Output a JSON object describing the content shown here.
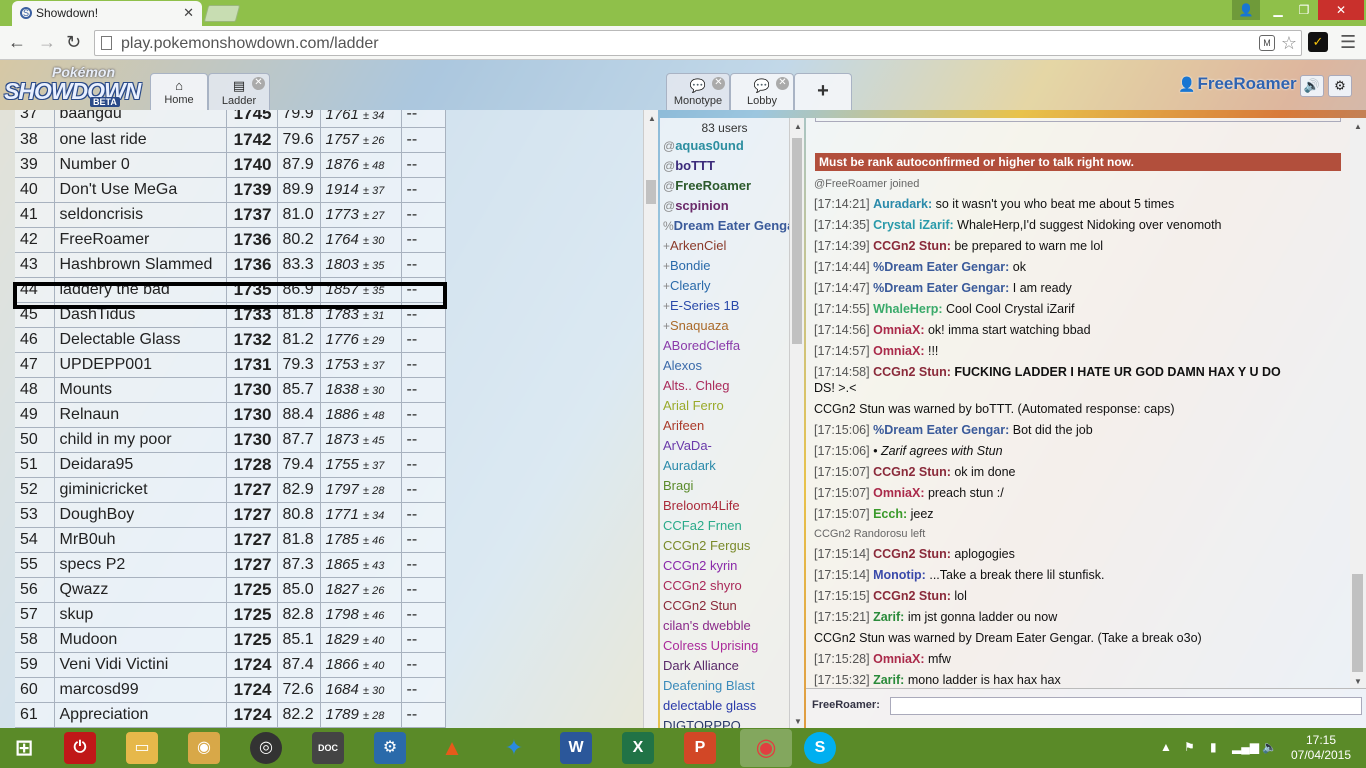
{
  "browser": {
    "tab_title": "Showdown!",
    "url": "play.pokemonshowdown.com/ladder"
  },
  "header": {
    "logo_pokemon": "Pokémon",
    "logo_showdown": "SHOWDOWN",
    "logo_beta": "BETA",
    "tabs": [
      {
        "label": "Home",
        "icon": "home-icon"
      },
      {
        "label": "Ladder",
        "icon": "ladder-icon"
      },
      {
        "label": "Monotype",
        "icon": "chat-bubble-icon"
      },
      {
        "label": "Lobby",
        "icon": "chat-bubble-icon"
      }
    ],
    "add_tab": "+",
    "username": "FreeRoamer"
  },
  "ladder": {
    "rows": [
      {
        "rank": "37",
        "name": "baangdu",
        "elo": "1745",
        "gxe": "79.9",
        "glicko": "1761",
        "dev": "± 34",
        "cov": "--"
      },
      {
        "rank": "38",
        "name": "one last ride",
        "elo": "1742",
        "gxe": "79.6",
        "glicko": "1757",
        "dev": "± 26",
        "cov": "--"
      },
      {
        "rank": "39",
        "name": "Number 0",
        "elo": "1740",
        "gxe": "87.9",
        "glicko": "1876",
        "dev": "± 48",
        "cov": "--"
      },
      {
        "rank": "40",
        "name": "Don't Use MeGa",
        "elo": "1739",
        "gxe": "89.9",
        "glicko": "1914",
        "dev": "± 37",
        "cov": "--"
      },
      {
        "rank": "41",
        "name": "seldoncrisis",
        "elo": "1737",
        "gxe": "81.0",
        "glicko": "1773",
        "dev": "± 27",
        "cov": "--"
      },
      {
        "rank": "42",
        "name": "FreeRoamer",
        "elo": "1736",
        "gxe": "80.2",
        "glicko": "1764",
        "dev": "± 30",
        "cov": "--"
      },
      {
        "rank": "43",
        "name": "Hashbrown Slammed",
        "elo": "1736",
        "gxe": "83.3",
        "glicko": "1803",
        "dev": "± 35",
        "cov": "--"
      },
      {
        "rank": "44",
        "name": "laddery the bad",
        "elo": "1735",
        "gxe": "86.9",
        "glicko": "1857",
        "dev": "± 35",
        "cov": "--"
      },
      {
        "rank": "45",
        "name": "DashTidus",
        "elo": "1733",
        "gxe": "81.8",
        "glicko": "1783",
        "dev": "± 31",
        "cov": "--"
      },
      {
        "rank": "46",
        "name": "Delectable Glass",
        "elo": "1732",
        "gxe": "81.2",
        "glicko": "1776",
        "dev": "± 29",
        "cov": "--"
      },
      {
        "rank": "47",
        "name": "UPDEPP001",
        "elo": "1731",
        "gxe": "79.3",
        "glicko": "1753",
        "dev": "± 37",
        "cov": "--"
      },
      {
        "rank": "48",
        "name": "Mounts",
        "elo": "1730",
        "gxe": "85.7",
        "glicko": "1838",
        "dev": "± 30",
        "cov": "--"
      },
      {
        "rank": "49",
        "name": "Relnaun",
        "elo": "1730",
        "gxe": "88.4",
        "glicko": "1886",
        "dev": "± 48",
        "cov": "--"
      },
      {
        "rank": "50",
        "name": "child in my poor",
        "elo": "1730",
        "gxe": "87.7",
        "glicko": "1873",
        "dev": "± 45",
        "cov": "--"
      },
      {
        "rank": "51",
        "name": "Deidara95",
        "elo": "1728",
        "gxe": "79.4",
        "glicko": "1755",
        "dev": "± 37",
        "cov": "--"
      },
      {
        "rank": "52",
        "name": "giminicricket",
        "elo": "1727",
        "gxe": "82.9",
        "glicko": "1797",
        "dev": "± 28",
        "cov": "--"
      },
      {
        "rank": "53",
        "name": "DoughBoy",
        "elo": "1727",
        "gxe": "80.8",
        "glicko": "1771",
        "dev": "± 34",
        "cov": "--"
      },
      {
        "rank": "54",
        "name": "MrB0uh",
        "elo": "1727",
        "gxe": "81.8",
        "glicko": "1785",
        "dev": "± 46",
        "cov": "--"
      },
      {
        "rank": "55",
        "name": "specs P2",
        "elo": "1727",
        "gxe": "87.3",
        "glicko": "1865",
        "dev": "± 43",
        "cov": "--"
      },
      {
        "rank": "56",
        "name": "Qwazz",
        "elo": "1725",
        "gxe": "85.0",
        "glicko": "1827",
        "dev": "± 26",
        "cov": "--"
      },
      {
        "rank": "57",
        "name": "skup",
        "elo": "1725",
        "gxe": "82.8",
        "glicko": "1798",
        "dev": "± 46",
        "cov": "--"
      },
      {
        "rank": "58",
        "name": "Mudoon",
        "elo": "1725",
        "gxe": "85.1",
        "glicko": "1829",
        "dev": "± 40",
        "cov": "--"
      },
      {
        "rank": "59",
        "name": "Veni Vidi Victini",
        "elo": "1724",
        "gxe": "87.4",
        "glicko": "1866",
        "dev": "± 40",
        "cov": "--"
      },
      {
        "rank": "60",
        "name": "marcosd99",
        "elo": "1724",
        "gxe": "72.6",
        "glicko": "1684",
        "dev": "± 30",
        "cov": "--"
      },
      {
        "rank": "61",
        "name": "Appreciation",
        "elo": "1724",
        "gxe": "82.2",
        "glicko": "1789",
        "dev": "± 28",
        "cov": "--"
      }
    ]
  },
  "userlist": {
    "count": "83 users",
    "users": [
      {
        "group": "@",
        "name": "aquas0und",
        "color": "#2c8ea0",
        "bold": true
      },
      {
        "group": "@",
        "name": "boTTT",
        "color": "#3b2a7a",
        "bold": true
      },
      {
        "group": "@",
        "name": "FreeRoamer",
        "color": "#2c5a2c",
        "bold": true
      },
      {
        "group": "@",
        "name": "scpinion",
        "color": "#6a2a6a",
        "bold": true
      },
      {
        "group": "%",
        "name": "Dream Eater Gengar",
        "color": "#3a5a9a",
        "bold": true
      },
      {
        "group": "+",
        "name": "ArkenCiel",
        "color": "#8a3a2a",
        "bold": false
      },
      {
        "group": "+",
        "name": "Bondie",
        "color": "#2a6aaa",
        "bold": false
      },
      {
        "group": "+",
        "name": "Clearly",
        "color": "#2a6aaa",
        "bold": false
      },
      {
        "group": "+",
        "name": "E-Series 1B",
        "color": "#2a4aaa",
        "bold": false
      },
      {
        "group": "+",
        "name": "Snaquaza",
        "color": "#aa6a2a",
        "bold": false
      },
      {
        "group": "",
        "name": "ABoredCleffa",
        "color": "#8a3aaa",
        "bold": false
      },
      {
        "group": "",
        "name": "Alexos",
        "color": "#3a6aaa",
        "bold": false
      },
      {
        "group": "",
        "name": "Alts.. Chleg",
        "color": "#aa2a5a",
        "bold": false
      },
      {
        "group": "",
        "name": "Arial Ferro",
        "color": "#9aaa2a",
        "bold": false
      },
      {
        "group": "",
        "name": "Arifeen",
        "color": "#aa3a2a",
        "bold": false
      },
      {
        "group": "",
        "name": "ArVaDa-",
        "color": "#6a3aaa",
        "bold": false
      },
      {
        "group": "",
        "name": "Auradark",
        "color": "#2a8aaa",
        "bold": false
      },
      {
        "group": "",
        "name": "Bragi",
        "color": "#5a8a2a",
        "bold": false
      },
      {
        "group": "",
        "name": "Breloom4Life",
        "color": "#aa2a3a",
        "bold": false
      },
      {
        "group": "",
        "name": "CCFa2 Frnen",
        "color": "#2aaa8a",
        "bold": false
      },
      {
        "group": "",
        "name": "CCGn2 Fergus",
        "color": "#7a8a2a",
        "bold": false
      },
      {
        "group": "",
        "name": "CCGn2 kyrin",
        "color": "#8a2aaa",
        "bold": false
      },
      {
        "group": "",
        "name": "CCGn2 shyro",
        "color": "#aa2a5a",
        "bold": false
      },
      {
        "group": "",
        "name": "CCGn2 Stun",
        "color": "#8a2a3a",
        "bold": false
      },
      {
        "group": "",
        "name": "cilan's dwebble",
        "color": "#8a2a8a",
        "bold": false
      },
      {
        "group": "",
        "name": "Colress Uprising",
        "color": "#aa2a9a",
        "bold": false
      },
      {
        "group": "",
        "name": "Dark Alliance",
        "color": "#5a2a6a",
        "bold": false
      },
      {
        "group": "",
        "name": "Deafening Blast",
        "color": "#3a8aba",
        "bold": false
      },
      {
        "group": "",
        "name": "delectable glass",
        "color": "#2a3aaa",
        "bold": false
      },
      {
        "group": "",
        "name": "DIGTORPPO",
        "color": "#2a3a6a",
        "bold": false
      }
    ]
  },
  "chat": {
    "warning": "Must be rank autoconfirmed or higher to talk right now.",
    "input_label": "FreeRoamer:",
    "lines": [
      {
        "type": "sys",
        "text": "@FreeRoamer joined"
      },
      {
        "type": "msg",
        "ts": "[17:14:21]",
        "name": "Auradark:",
        "color": "#2a8aaa",
        "text": "so it wasn't you who beat me about 5 times"
      },
      {
        "type": "msg",
        "ts": "[17:14:35]",
        "name": "Crystal iZarif:",
        "color": "#2a9aaa",
        "text": "WhaleHerp,I'd suggest Nidoking over venomoth"
      },
      {
        "type": "msg",
        "ts": "[17:14:39]",
        "name": "CCGn2 Stun:",
        "color": "#8a2a3a",
        "text": "be prepared to warn me lol"
      },
      {
        "type": "msg",
        "ts": "[17:14:44]",
        "name": "%Dream Eater Gengar:",
        "color": "#3a5a9a",
        "text": "ok"
      },
      {
        "type": "msg",
        "ts": "[17:14:47]",
        "name": "%Dream Eater Gengar:",
        "color": "#3a5a9a",
        "text": "I am ready"
      },
      {
        "type": "msg",
        "ts": "[17:14:55]",
        "name": "WhaleHerp:",
        "color": "#3aaa6a",
        "text": "Cool Cool Crystal iZarif"
      },
      {
        "type": "msg",
        "ts": "[17:14:56]",
        "name": "OmniaX:",
        "color": "#aa2a4a",
        "text": "ok! imma start watching bbad"
      },
      {
        "type": "msg",
        "ts": "[17:14:57]",
        "name": "OmniaX:",
        "color": "#aa2a4a",
        "text": "!!!"
      },
      {
        "type": "msg",
        "ts": "[17:14:58]",
        "name": "CCGn2 Stun:",
        "color": "#8a2a3a",
        "text": "FUCKING LADDER I HATE UR GOD DAMN HAX Y U DO",
        "bold": true
      },
      {
        "type": "cont",
        "text": "DS! >.<"
      },
      {
        "type": "notice",
        "text": "CCGn2 Stun was warned by boTTT. (Automated response: caps)"
      },
      {
        "type": "msg",
        "ts": "[17:15:06]",
        "name": "%Dream Eater Gengar:",
        "color": "#3a5a9a",
        "text": "Bot did the job"
      },
      {
        "type": "emote",
        "ts": "[17:15:06]",
        "text": "• Zarif agrees with Stun"
      },
      {
        "type": "msg",
        "ts": "[17:15:07]",
        "name": "CCGn2 Stun:",
        "color": "#8a2a3a",
        "text": "ok im done"
      },
      {
        "type": "msg",
        "ts": "[17:15:07]",
        "name": "OmniaX:",
        "color": "#aa2a4a",
        "text": "preach stun :/"
      },
      {
        "type": "msg",
        "ts": "[17:15:07]",
        "name": "Ecch:",
        "color": "#3a9a2a",
        "text": "jeez"
      },
      {
        "type": "sys",
        "text": "CCGn2 Randorosu left"
      },
      {
        "type": "msg",
        "ts": "[17:15:14]",
        "name": "CCGn2 Stun:",
        "color": "#8a2a3a",
        "text": "aplogogies"
      },
      {
        "type": "msg",
        "ts": "[17:15:14]",
        "name": "Monotip:",
        "color": "#3a4aaa",
        "text": "...Take a break there lil stunfisk."
      },
      {
        "type": "msg",
        "ts": "[17:15:15]",
        "name": "CCGn2 Stun:",
        "color": "#8a2a3a",
        "text": "lol"
      },
      {
        "type": "msg",
        "ts": "[17:15:21]",
        "name": "Zarif:",
        "color": "#2a8a3a",
        "text": "im jst gonna ladder ou now"
      },
      {
        "type": "notice",
        "text": "CCGn2 Stun was warned by Dream Eater Gengar. (Take a break o3o)"
      },
      {
        "type": "msg",
        "ts": "[17:15:28]",
        "name": "OmniaX:",
        "color": "#aa2a4a",
        "text": "mfw"
      },
      {
        "type": "msg",
        "ts": "[17:15:32]",
        "name": "Zarif:",
        "color": "#2a8a3a",
        "text": "mono ladder is hax hax hax"
      }
    ]
  },
  "taskbar": {
    "time": "17:15",
    "date": "07/04/2015"
  },
  "colors": {
    "chrome_frame": "#8fc04a",
    "warning_bar": "#b24f3c",
    "username": "#2f63b0"
  }
}
